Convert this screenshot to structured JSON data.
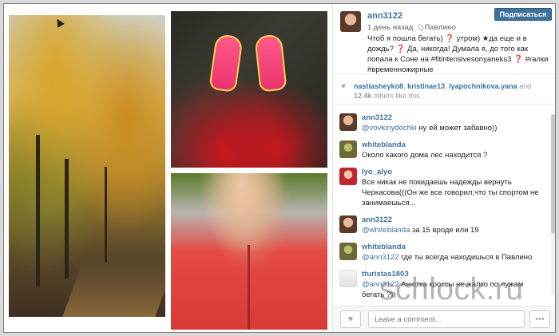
{
  "post": {
    "username": "ann3122",
    "time_ago": "1 день назад",
    "location": "Павлино",
    "follow_label": "Подписаться",
    "caption": "Чтоб я пошла бегать) ❓ утром) ★да еще и в дождь? ❓ Да, никогда! Думала я, до того как попала к Соне на #fitintensivesonyaneks3 ❓ #галки #временножирные"
  },
  "likes": {
    "users": [
      "nastiasheyko8",
      "kristinae13",
      "lyapochnikova.yana"
    ],
    "and_label": "and",
    "count": "12.4k",
    "suffix": "others like this."
  },
  "comments": [
    {
      "user": "ann3122",
      "mention": "@vovkinydochki",
      "text": "ну ей может забавно))"
    },
    {
      "user": "whiteblanda",
      "mention": "",
      "text": "Около какого дома лес находится ?"
    },
    {
      "user": "lyo_alyo",
      "mention": "",
      "text": "Все никак не покидаешь надежды вернуть Черкасова(((Он же все говорил,что ты спортом не занимаешься..."
    },
    {
      "user": "ann3122",
      "mention": "@whiteblanda",
      "text": "за 15 вроде или 19"
    },
    {
      "user": "whiteblanda",
      "mention": "@ann3122",
      "text": "где ты всегда находишься в Павлино"
    },
    {
      "user": "tturistas1803",
      "mention": "@ann3122",
      "text": "Анютка кроссы не жалко по лужам бегать ?))"
    }
  ],
  "footer": {
    "comment_placeholder": "Leave a comment...",
    "more_label": "•••",
    "heart_label": "♥"
  },
  "watermark": "schlock.ru",
  "icons": {
    "heart": "heart-icon",
    "location": "location-pin-icon",
    "more": "more-icon"
  }
}
